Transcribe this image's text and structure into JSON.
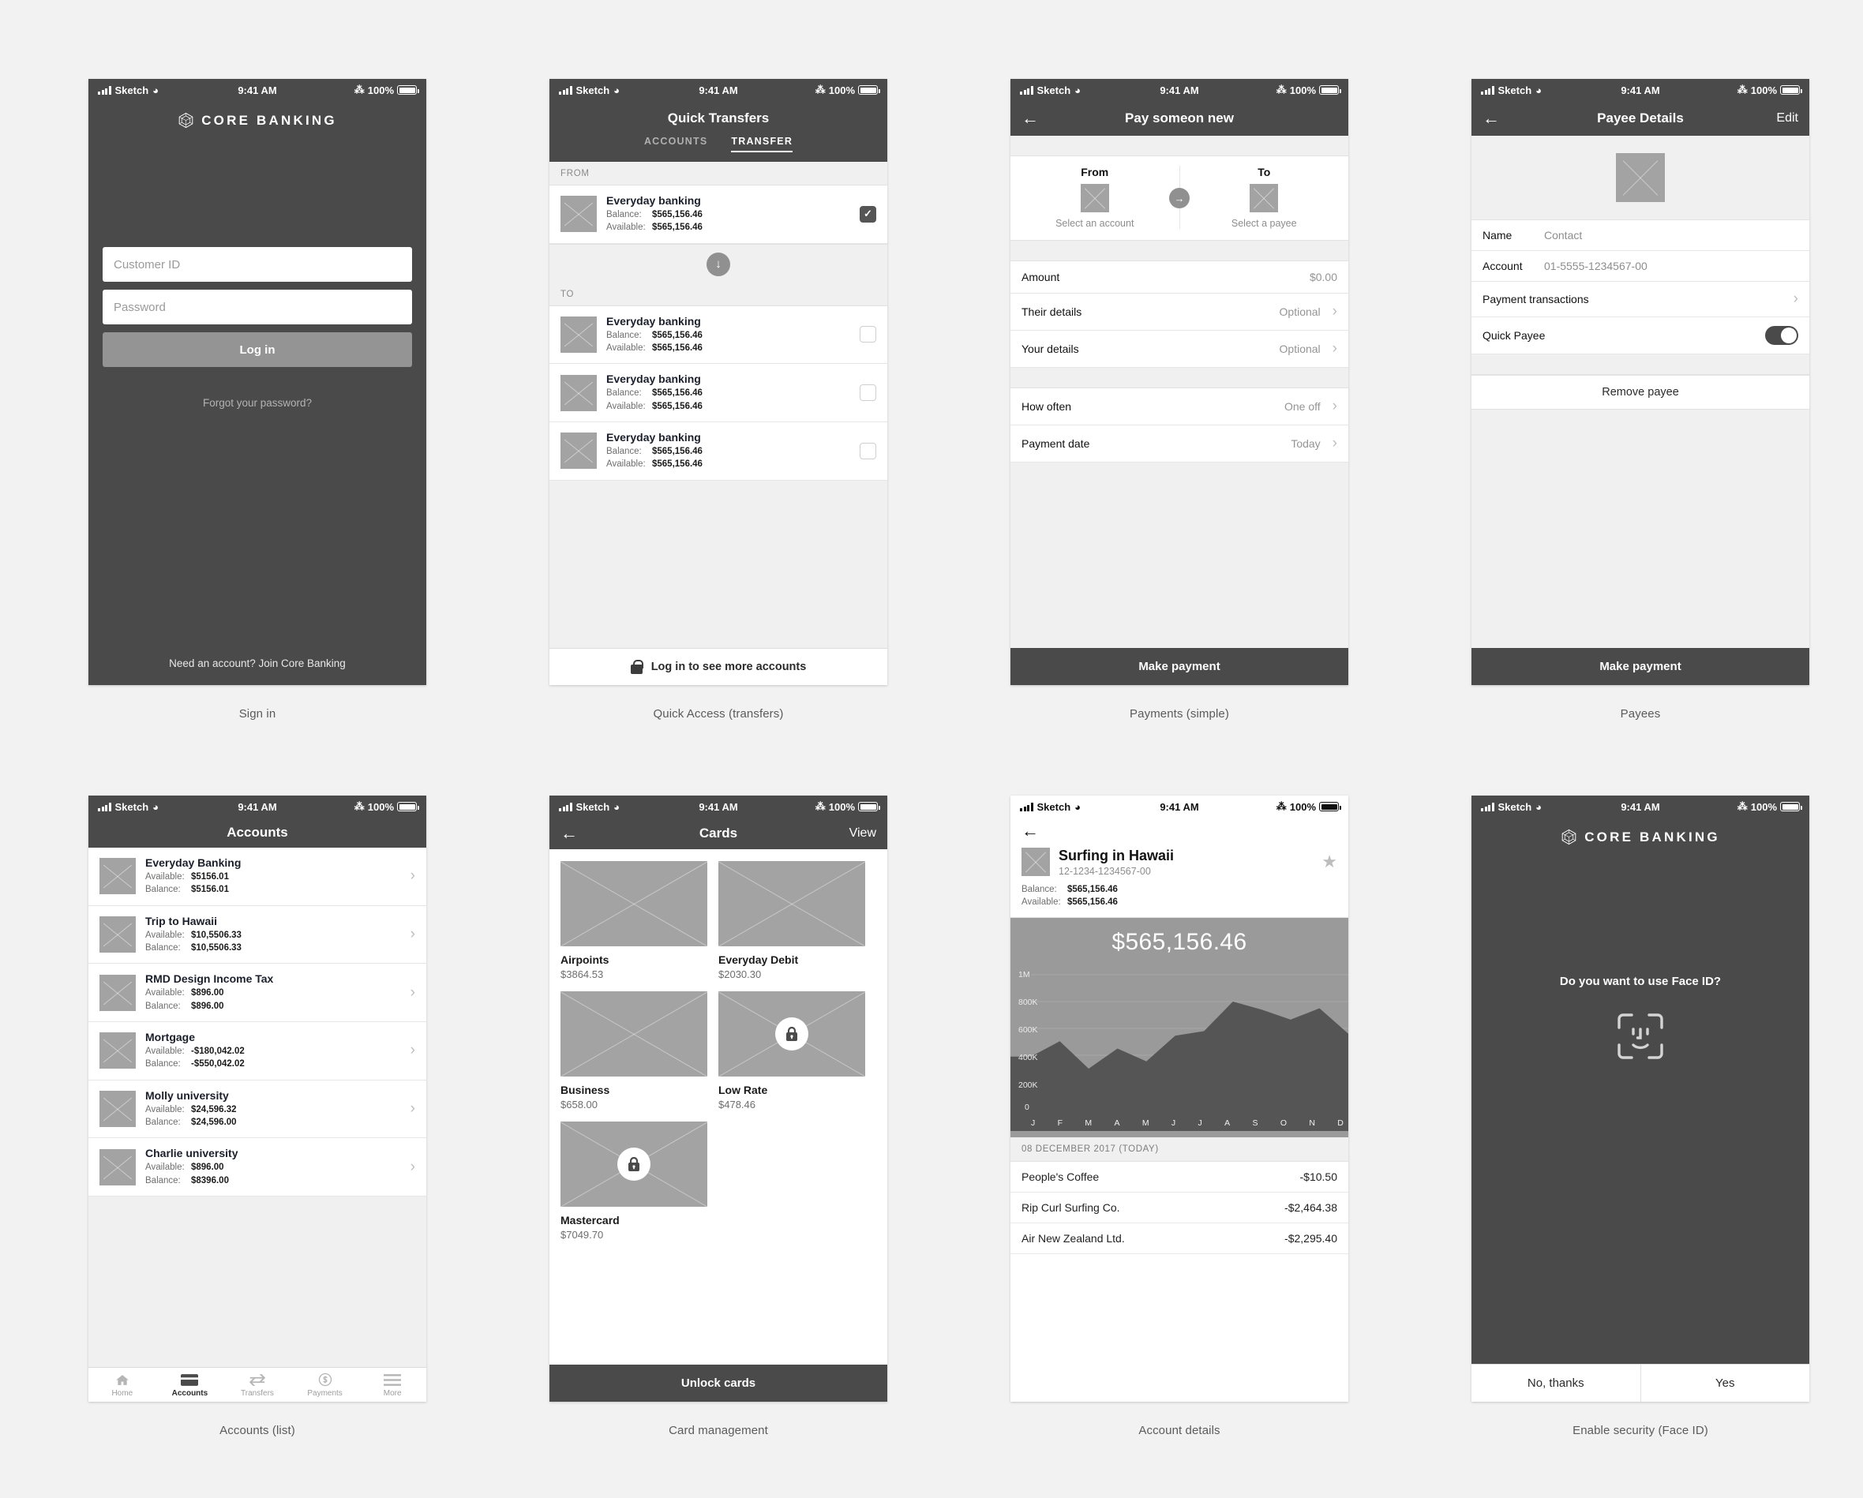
{
  "status_bar": {
    "carrier": "Sketch",
    "time": "9:41 AM",
    "battery": "100%"
  },
  "brand": {
    "name": "CORE BANKING"
  },
  "screens": {
    "signin": {
      "caption": "Sign in",
      "customer_id_placeholder": "Customer ID",
      "password_placeholder": "Password",
      "login_label": "Log in",
      "forgot_label": "Forgot your password?",
      "join_label": "Need an account? Join Core Banking"
    },
    "quick_transfers": {
      "caption": "Quick Access (transfers)",
      "title": "Quick Transfers",
      "tabs": [
        {
          "label": "ACCOUNTS",
          "active": false
        },
        {
          "label": "TRANSFER",
          "active": true
        }
      ],
      "from_header": "FROM",
      "to_header": "TO",
      "balance_label": "Balance:",
      "available_label": "Available:",
      "from_accounts": [
        {
          "name": "Everyday banking",
          "balance": "$565,156.46",
          "available": "$565,156.46",
          "checked": true
        }
      ],
      "to_accounts": [
        {
          "name": "Everyday banking",
          "balance": "$565,156.46",
          "available": "$565,156.46",
          "checked": false
        },
        {
          "name": "Everyday banking",
          "balance": "$565,156.46",
          "available": "$565,156.46",
          "checked": false
        },
        {
          "name": "Everyday banking",
          "balance": "$565,156.46",
          "available": "$565,156.46",
          "checked": false
        }
      ],
      "footer_label": "Log in to see more accounts"
    },
    "payments": {
      "caption": "Payments (simple)",
      "title": "Pay someon new",
      "from_title": "From",
      "from_sub": "Select an account",
      "to_title": "To",
      "to_sub": "Select a payee",
      "rows_group_1": [
        {
          "key": "Amount",
          "value": "$0.00",
          "chevron": false
        },
        {
          "key": "Their details",
          "value": "Optional",
          "chevron": true
        },
        {
          "key": "Your details",
          "value": "Optional",
          "chevron": true
        }
      ],
      "rows_group_2": [
        {
          "key": "How often",
          "value": "One off",
          "chevron": true
        },
        {
          "key": "Payment date",
          "value": "Today",
          "chevron": true
        }
      ],
      "cta_label": "Make payment"
    },
    "payees": {
      "caption": "Payees",
      "title": "Payee Details",
      "edit_label": "Edit",
      "rows": [
        {
          "key": "Name",
          "value": "Contact",
          "type": "text"
        },
        {
          "key": "Account",
          "value": "01-5555-1234567-00",
          "type": "text"
        },
        {
          "key": "Payment transactions",
          "value": "",
          "type": "chevron"
        },
        {
          "key": "Quick Payee",
          "value": "on",
          "type": "toggle"
        }
      ],
      "remove_label": "Remove payee",
      "cta_label": "Make payment"
    },
    "accounts_list": {
      "caption": "Accounts (list)",
      "title": "Accounts",
      "available_label": "Available:",
      "balance_label": "Balance:",
      "accounts": [
        {
          "name": "Everyday Banking",
          "available": "$5156.01",
          "balance": "$5156.01"
        },
        {
          "name": "Trip to Hawaii",
          "available": "$10,5506.33",
          "balance": "$10,5506.33"
        },
        {
          "name": "RMD Design Income Tax",
          "available": "$896.00",
          "balance": "$896.00"
        },
        {
          "name": "Mortgage",
          "available": "-$180,042.02",
          "balance": "-$550,042.02"
        },
        {
          "name": "Molly university",
          "available": "$24,596.32",
          "balance": "$24,596.00"
        },
        {
          "name": "Charlie university",
          "available": "$896.00",
          "balance": "$8396.00"
        }
      ],
      "tabbar": [
        {
          "label": "Home",
          "icon": "home-icon",
          "active": false
        },
        {
          "label": "Accounts",
          "icon": "card-icon",
          "active": true
        },
        {
          "label": "Transfers",
          "icon": "transfer-arrows-icon",
          "active": false
        },
        {
          "label": "Payments",
          "icon": "dollar-coin-icon",
          "active": false
        },
        {
          "label": "More",
          "icon": "hamburger-icon",
          "active": false
        }
      ]
    },
    "cards": {
      "caption": "Card management",
      "title": "Cards",
      "view_label": "View",
      "cards": [
        {
          "name": "Airpoints",
          "amount": "$3864.53",
          "locked": false
        },
        {
          "name": "Everyday Debit",
          "amount": "$2030.30",
          "locked": false
        },
        {
          "name": "Business",
          "amount": "$658.00",
          "locked": false
        },
        {
          "name": "Low Rate",
          "amount": "$478.46",
          "locked": true
        },
        {
          "name": "Mastercard",
          "amount": "$7049.70",
          "locked": true
        }
      ],
      "cta_label": "Unlock cards"
    },
    "account_details": {
      "caption": "Account details",
      "account_name": "Surfing in Hawaii",
      "account_number": "12-1234-1234567-00",
      "balance_label": "Balance:",
      "available_label": "Available:",
      "balance": "$565,156.46",
      "available": "$565,156.46",
      "hero_amount": "$565,156.46",
      "txn_date_header": "08 DECEMBER 2017 (TODAY)",
      "transactions": [
        {
          "name": "People's Coffee",
          "amount": "-$10.50"
        },
        {
          "name": "Rip Curl Surfing Co.",
          "amount": "-$2,464.38"
        },
        {
          "name": "Air New Zealand Ltd.",
          "amount": "-$2,295.40"
        }
      ]
    },
    "faceid": {
      "caption": "Enable security (Face ID)",
      "question": "Do you want to use Face ID?",
      "no_label": "No, thanks",
      "yes_label": "Yes"
    }
  },
  "chart_data": {
    "type": "area",
    "title": "$565,156.46",
    "categories": [
      "J",
      "F",
      "M",
      "A",
      "M",
      "J",
      "J",
      "A",
      "S",
      "O",
      "N",
      "D"
    ],
    "values": [
      390000,
      505000,
      300000,
      450000,
      355000,
      545000,
      580000,
      800000,
      740000,
      665000,
      750000,
      560000
    ],
    "xlabel": "",
    "ylabel": "",
    "ylim": [
      0,
      1000000
    ],
    "ytick_labels": [
      "1M",
      "800K",
      "600K",
      "400K",
      "200K",
      "0"
    ],
    "ytick_values": [
      1000000,
      800000,
      600000,
      400000,
      200000,
      0
    ],
    "grid": true,
    "legend": "none",
    "area_color": "#555555",
    "bg_color": "#9a9a9a"
  }
}
